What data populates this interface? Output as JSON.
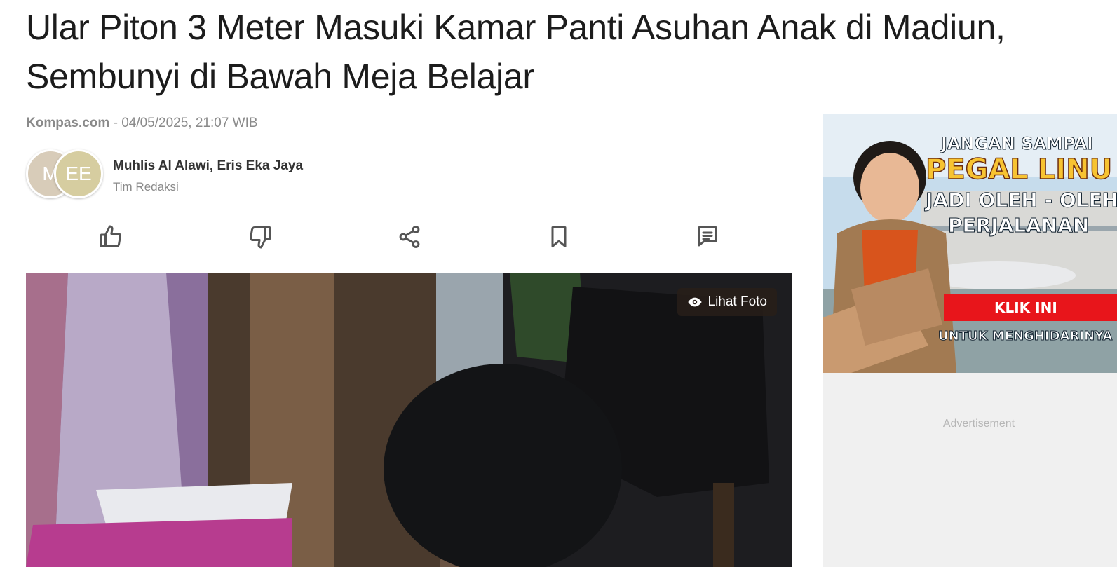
{
  "article": {
    "title_line1": "Ular Piton 3 Meter Masuki Kamar Panti Asuhan Anak di Madiun,",
    "title_line2": "Sembunyi di Bawah Meja Belajar",
    "source": "Kompas.com",
    "separator": " - ",
    "datetime": "04/05/2025, 21:07 WIB"
  },
  "authors": {
    "avatars": [
      "M",
      "EE"
    ],
    "names": "Muhlis Al Alawi,  Eris Eka Jaya",
    "team": "Tim Redaksi"
  },
  "actions": {
    "icons": [
      "thumbs-up-icon",
      "thumbs-down-icon",
      "share-icon",
      "bookmark-icon",
      "comment-icon"
    ]
  },
  "hero": {
    "view_photo_label": "Lihat Foto"
  },
  "ad": {
    "line1": "JANGAN SAMPAI",
    "line2": "PEGAL LINU",
    "line3": "JADI OLEH - OLEH",
    "line4": "PERJALANAN",
    "cta": "KLIK INI",
    "line5": "UNTUK MENGHIDARINYA",
    "slot_label": "Advertisement"
  }
}
